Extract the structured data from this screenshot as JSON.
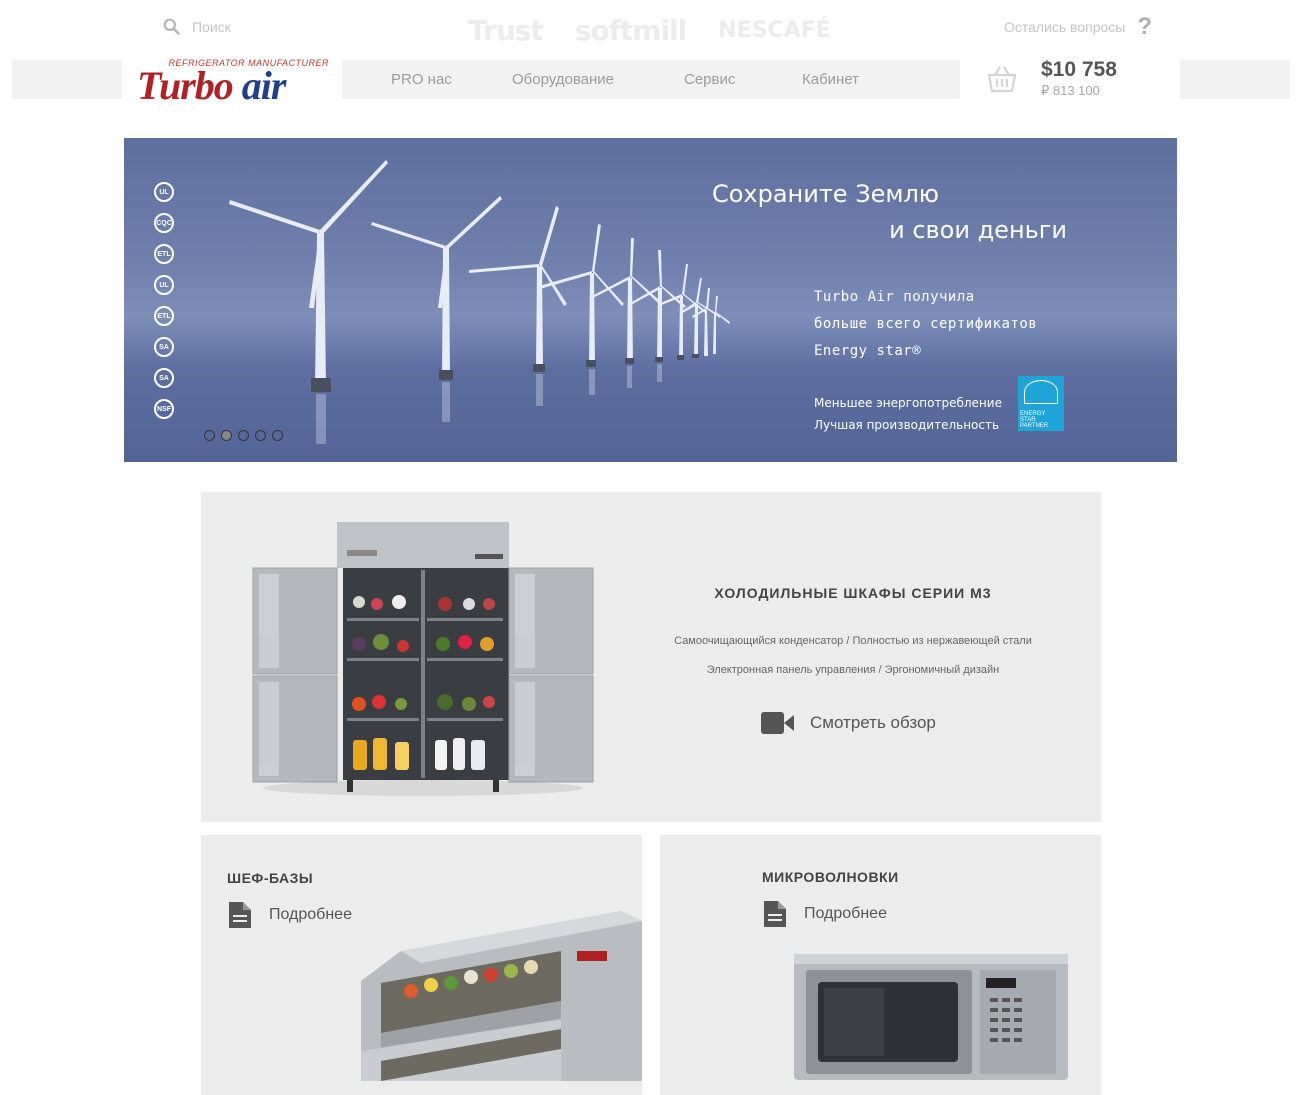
{
  "header": {
    "search_placeholder": "Поиск",
    "partners": [
      "Trust",
      "softmill",
      "NESCAFÉ"
    ],
    "questions_label": "Остались вопросы",
    "questions_icon": "question-icon",
    "logo": {
      "text_red": "Turbo",
      "text_blue": "air",
      "tagline": "REFRIGERATOR MANUFACTURER"
    },
    "nav": [
      "PRO нас",
      "Оборудование",
      "Сервис",
      "Кабинет"
    ],
    "cart_icon": "basket-icon",
    "price_usd": "$10 758",
    "price_rub": "₽ 813 100"
  },
  "hero": {
    "title_line1": "Сохраните Землю",
    "title_line2": "и свои деньги",
    "text_line1": "Turbo Air получила",
    "text_line2": "больше всего сертификатов",
    "text_line3": "Energy star®",
    "small_line1": "Меньшее энергопотребление",
    "small_line2": "Лучшая производительность",
    "badge_text": "ENERGY STAR PARTNER",
    "certs": [
      "UL",
      "CQC",
      "ETL",
      "UL",
      "ETL",
      "SA",
      "SA",
      "NSF"
    ],
    "slides": 5,
    "active_slide": 2
  },
  "feature": {
    "title": "ХОЛОДИЛЬНЫЕ ШКАФЫ СЕРИИ М3",
    "line1": "Самоочищающийся конденсатор / Полностью из нержавеющей стали",
    "line2": "Электронная панель управления / Эргономичный дизайн",
    "video_label": "Смотреть обзор",
    "video_icon": "video-camera-icon"
  },
  "cards": [
    {
      "title": "ШЕФ-БАЗЫ",
      "link": "Подробнее",
      "icon": "document-icon"
    },
    {
      "title": "МИКРОВОЛНОВКИ",
      "link": "Подробнее",
      "icon": "document-icon"
    }
  ],
  "colors": {
    "logo_red": "#b21f24",
    "logo_blue": "#1f3f8c",
    "nav_bg": "#f2f2f2",
    "card_bg": "#ececec",
    "energy_star": "#1fa4d8"
  }
}
